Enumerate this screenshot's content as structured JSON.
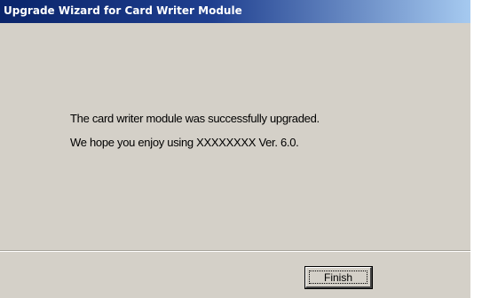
{
  "window": {
    "title": "Upgrade Wizard for Card Writer Module"
  },
  "content": {
    "message_line_1": "The card writer module was successfully upgraded.",
    "message_line_2": "We hope you enjoy using XXXXXXXX Ver. 6.0."
  },
  "buttons": {
    "finish_label": "Finish"
  },
  "colors": {
    "dialog_background": "#d4d0c8",
    "titlebar_start": "#0a246a",
    "titlebar_end": "#a6caf0",
    "title_text": "#ffffff"
  }
}
